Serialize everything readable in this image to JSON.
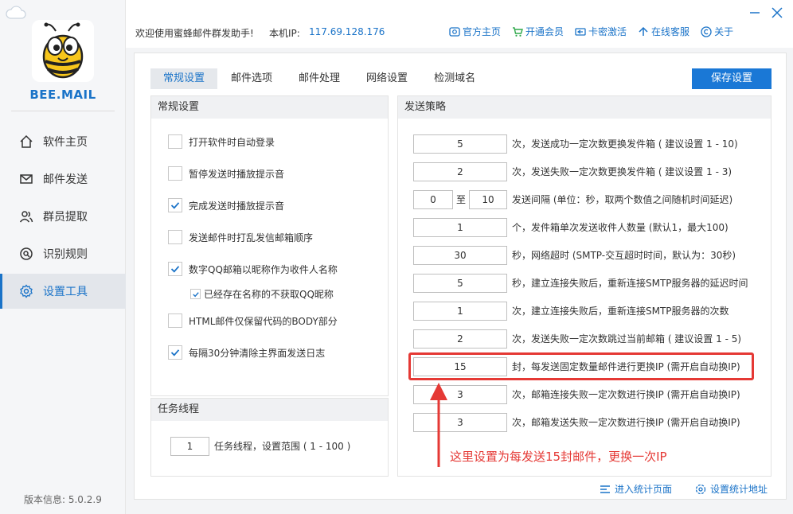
{
  "app": {
    "brand": "BEE.MAIL",
    "version_label": "版本信息: 5.0.2.9"
  },
  "nav": {
    "items": [
      {
        "label": "软件主页",
        "icon": "home-icon"
      },
      {
        "label": "邮件发送",
        "icon": "mail-icon"
      },
      {
        "label": "群员提取",
        "icon": "users-icon"
      },
      {
        "label": "识别规则",
        "icon": "search-icon"
      },
      {
        "label": "设置工具",
        "icon": "gear-icon",
        "active": true
      }
    ]
  },
  "topbar": {
    "welcome": "欢迎使用蜜蜂邮件群发助手!",
    "ip_label": "本机IP:",
    "ip_value": "117.69.128.176",
    "links": [
      {
        "label": "官方主页",
        "icon": "website-icon"
      },
      {
        "label": "开通会员",
        "icon": "cart-icon"
      },
      {
        "label": "卡密激活",
        "icon": "card-icon"
      },
      {
        "label": "在线客服",
        "icon": "service-icon"
      },
      {
        "label": "关于",
        "icon": "copyright-icon"
      }
    ]
  },
  "tabs": [
    "常规设置",
    "邮件选项",
    "邮件处理",
    "网络设置",
    "检测域名"
  ],
  "save_button": "保存设置",
  "general": {
    "title": "常规设置",
    "options": [
      {
        "label": "打开软件时自动登录",
        "checked": false
      },
      {
        "label": "暂停发送时播放提示音",
        "checked": false
      },
      {
        "label": "完成发送时播放提示音",
        "checked": true
      },
      {
        "label": "发送邮件时打乱发信邮箱顺序",
        "checked": false
      },
      {
        "label": "数字QQ邮箱以昵称作为收件人名称",
        "checked": true
      },
      {
        "label": "已经存在名称的不获取QQ昵称",
        "checked": true,
        "sub": true
      },
      {
        "label": "HTML邮件仅保留代码的BODY部分",
        "checked": false
      },
      {
        "label": "每隔30分钟清除主界面发送日志",
        "checked": true
      }
    ]
  },
  "threads": {
    "title": "任务线程",
    "value": "1",
    "label": "任务线程，设置范围 ( 1 - 100 )"
  },
  "strategy": {
    "title": "发送策略",
    "rows": [
      {
        "value": "5",
        "label": "次，发送成功一定次数更换发件箱 ( 建议设置 1 - 10)"
      },
      {
        "value": "2",
        "label": "次，发送失败一定次数更换发件箱 ( 建议设置 1 - 3)"
      },
      {
        "from": "0",
        "to_label": "至",
        "to": "10",
        "label": "发送间隔 (单位：秒，取两个数值之间随机时间延迟)"
      },
      {
        "value": "1",
        "label": "个，发件箱单次发送收件人数量 (默认1，最大100)"
      },
      {
        "value": "30",
        "label": "秒，网络超时 (SMTP-交互超时时间，默认为：30秒)"
      },
      {
        "value": "5",
        "label": "秒，建立连接失败后，重新连接SMTP服务器的延迟时间"
      },
      {
        "value": "1",
        "label": "次，建立连接失败后，重新连接SMTP服务器的次数"
      },
      {
        "value": "2",
        "label": "次，发送失败一定次数跳过当前邮箱 ( 建议设置 1 - 5)"
      },
      {
        "value": "15",
        "label": "封，每发送固定数量邮件进行更换IP (需开启自动换IP)"
      },
      {
        "value": "3",
        "label": "次，邮箱连接失败一定次数进行换IP (需开启自动换IP)"
      },
      {
        "value": "3",
        "label": "次，邮箱发送失败一定次数进行换IP (需开启自动换IP)"
      }
    ]
  },
  "annotation": "这里设置为每发送15封邮件，更换一次IP",
  "bottom_links": [
    {
      "label": "进入统计页面",
      "icon": "stats-icon"
    },
    {
      "label": "设置统计地址",
      "icon": "settings-icon"
    }
  ],
  "colors": {
    "accent": "#1a73c8",
    "annotation": "#e53935"
  }
}
